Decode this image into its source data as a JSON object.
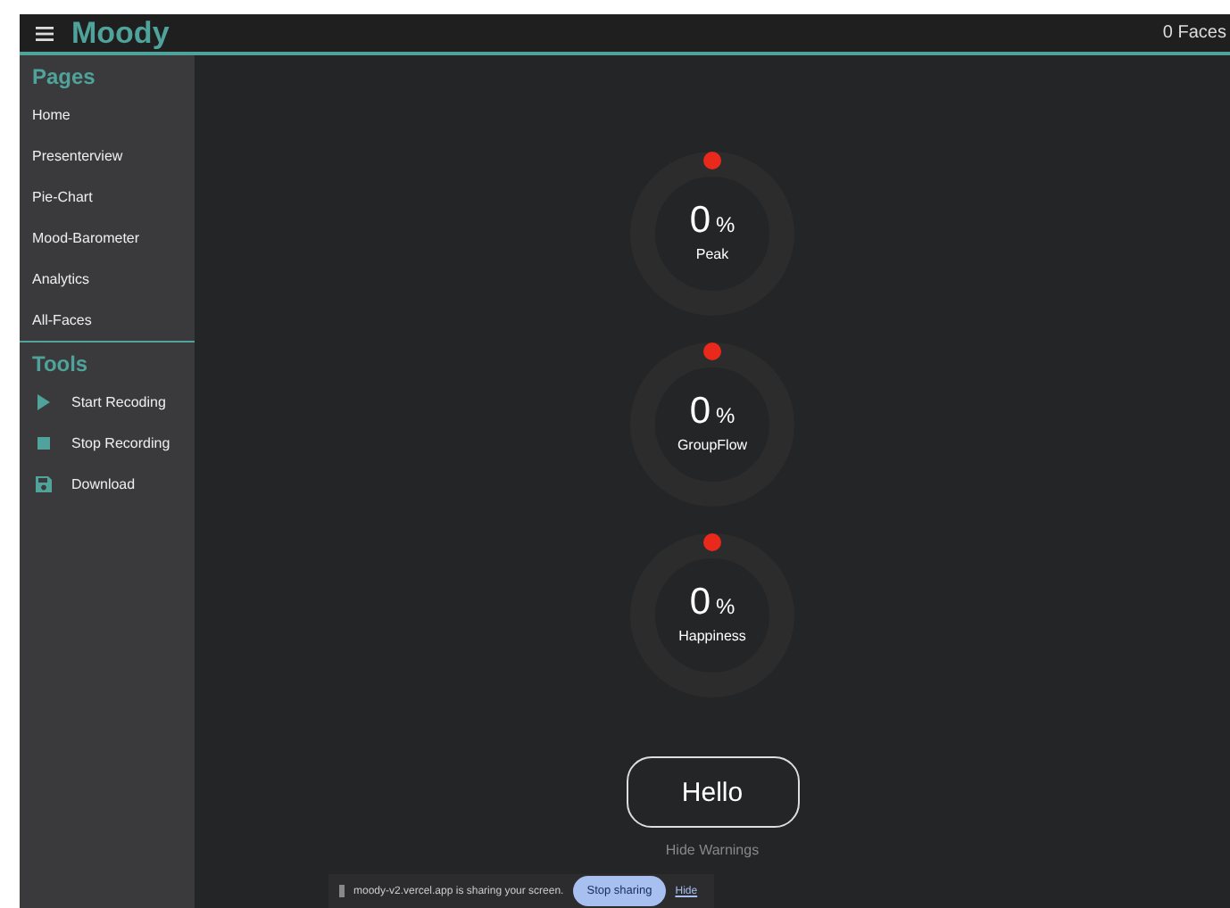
{
  "header": {
    "logo": "Moody",
    "faces": "0 Faces"
  },
  "sidebar": {
    "sections": [
      {
        "title": "Pages",
        "items": [
          {
            "label": "Home"
          },
          {
            "label": "Presenterview"
          },
          {
            "label": "Pie-Chart"
          },
          {
            "label": "Mood-Barometer"
          },
          {
            "label": "Analytics"
          },
          {
            "label": "All-Faces"
          }
        ]
      },
      {
        "title": "Tools",
        "items": [
          {
            "label": "Start Recoding",
            "kind": "play"
          },
          {
            "label": "Stop Recording",
            "kind": "stop"
          },
          {
            "label": "Download",
            "kind": "save"
          }
        ]
      }
    ]
  },
  "gauges": [
    {
      "value": "0",
      "unit": "%",
      "label": "Peak"
    },
    {
      "value": "0",
      "unit": "%",
      "label": "GroupFlow"
    },
    {
      "value": "0",
      "unit": "%",
      "label": "Happiness"
    }
  ],
  "hello_button": "Hello",
  "hide_warnings": "Hide Warnings",
  "share_bar": {
    "message": "moody-v2.vercel.app is sharing your screen.",
    "stop": "Stop sharing",
    "hide": "Hide"
  }
}
